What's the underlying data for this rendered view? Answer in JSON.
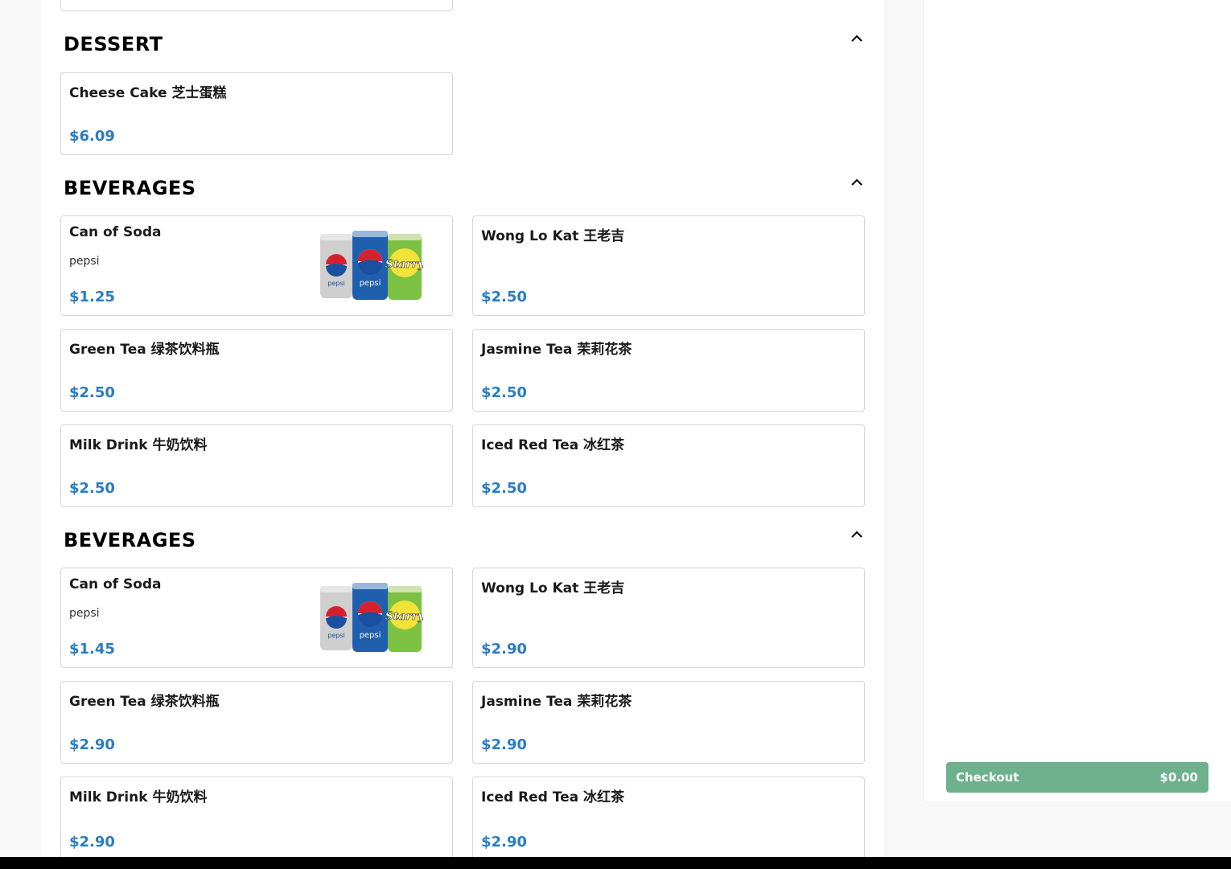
{
  "sections": [
    {
      "title": "DESSERT",
      "items": [
        {
          "name": "Cheese Cake 芝士蛋糕",
          "price": "$6.09"
        }
      ]
    },
    {
      "title": "BEVERAGES",
      "items": [
        {
          "name": "Can of Soda",
          "desc": "pepsi",
          "price": "$1.25",
          "image": "soda-cans-image"
        },
        {
          "name": "Wong Lo Kat 王老吉",
          "price": "$2.50"
        },
        {
          "name": "Green Tea 绿茶饮料瓶",
          "price": "$2.50"
        },
        {
          "name": "Jasmine Tea 茉莉花茶",
          "price": "$2.50"
        },
        {
          "name": "Milk Drink 牛奶饮料",
          "price": "$2.50"
        },
        {
          "name": "Iced Red Tea 冰红茶",
          "price": "$2.50"
        }
      ]
    },
    {
      "title": "BEVERAGES",
      "items": [
        {
          "name": "Can of Soda",
          "desc": "pepsi",
          "price": "$1.45",
          "image": "soda-cans-image"
        },
        {
          "name": "Wong Lo Kat 王老吉",
          "price": "$2.90"
        },
        {
          "name": "Green Tea 绿茶饮料瓶",
          "price": "$2.90"
        },
        {
          "name": "Jasmine Tea 茉莉花茶",
          "price": "$2.90"
        },
        {
          "name": "Milk Drink 牛奶饮料",
          "price": "$2.90"
        },
        {
          "name": "Iced Red Tea 冰红茶",
          "price": "$2.90"
        }
      ]
    }
  ],
  "checkout": {
    "label": "Checkout",
    "amount": "$0.00"
  },
  "colors": {
    "price": "#2a7cc2",
    "checkout": "#6db28d"
  },
  "icons": {
    "section_toggle": "chevron-up-icon"
  }
}
